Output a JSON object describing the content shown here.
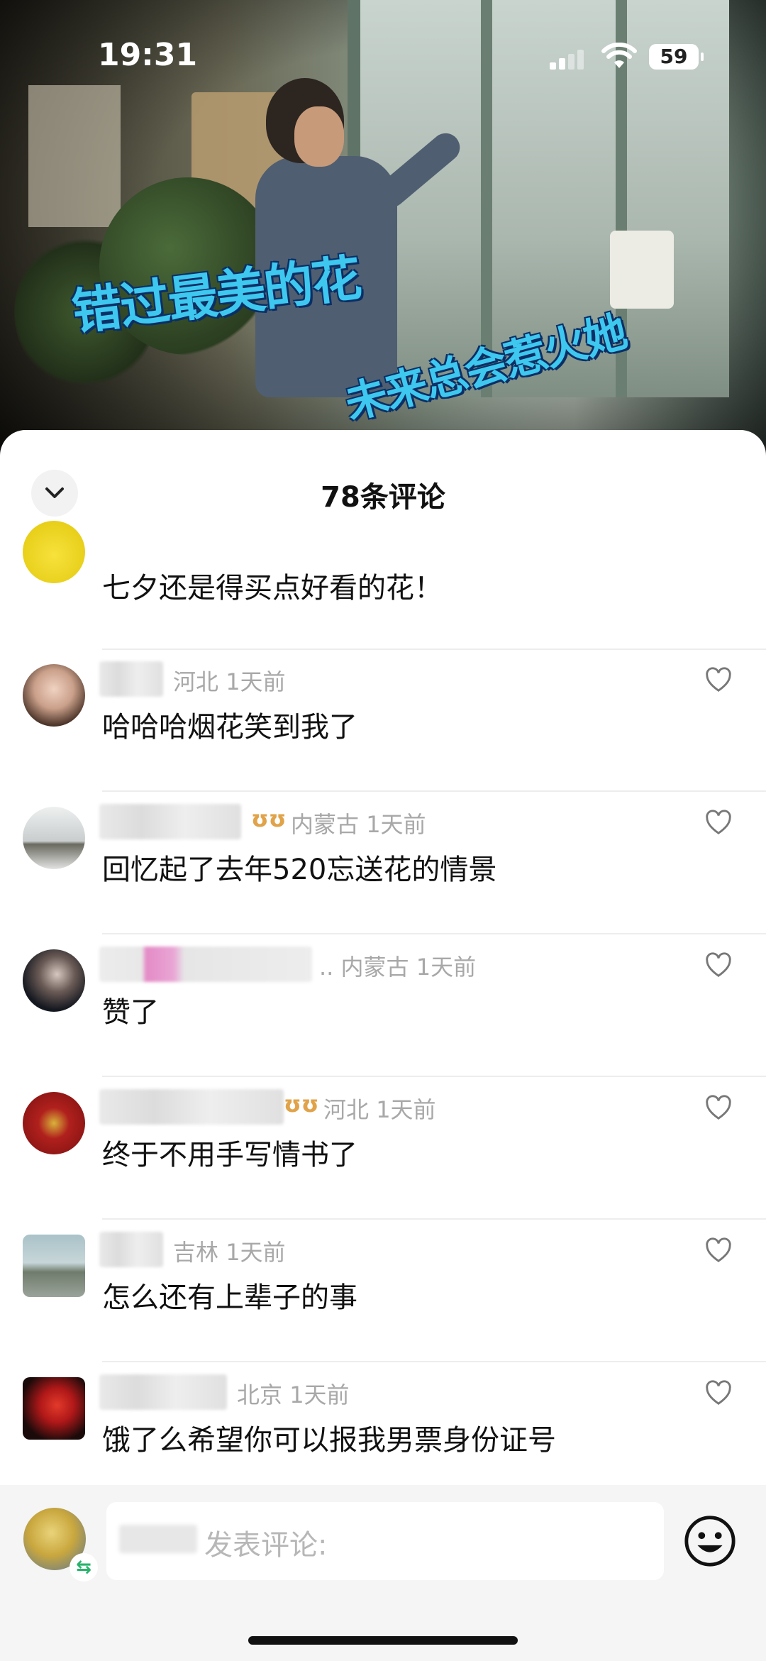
{
  "status_bar": {
    "time": "19:31",
    "battery": "59"
  },
  "video": {
    "caption_line1": "错过最美的花",
    "caption_line2": "未来总会惹火她"
  },
  "sheet": {
    "title": "78条评论"
  },
  "comments": [
    {
      "location": "",
      "time": "",
      "text": "七夕还是得买点好看的花！",
      "vip": false
    },
    {
      "location": "河北",
      "time": "1天前",
      "text": "哈哈哈烟花笑到我了",
      "vip": false
    },
    {
      "location": "内蒙古",
      "time": "1天前",
      "text": "回忆起了去年520忘送花的情景",
      "vip": true
    },
    {
      "location": "内蒙古",
      "time": "1天前",
      "text": "赞了",
      "vip": false,
      "name_suffix": ".."
    },
    {
      "location": "河北",
      "time": "1天前",
      "text": "终于不用手写情书了",
      "vip": true
    },
    {
      "location": "吉林",
      "time": "1天前",
      "text": "怎么还有上辈子的事",
      "vip": false
    },
    {
      "location": "北京",
      "time": "1天前",
      "text": "饿了么希望你可以报我男票身份证号",
      "vip": false
    }
  ],
  "input": {
    "placeholder": "发表评论:"
  },
  "icons": {
    "collapse": "chevron-down-icon",
    "like": "heart-outline-icon",
    "emoji": "emoji-icon",
    "vip": "vip-badge-icon",
    "switch": "switch-account-icon"
  },
  "colors": {
    "caption": "#3ec8f0",
    "vip": "#e0a34a",
    "meta": "#a8a8a8"
  }
}
